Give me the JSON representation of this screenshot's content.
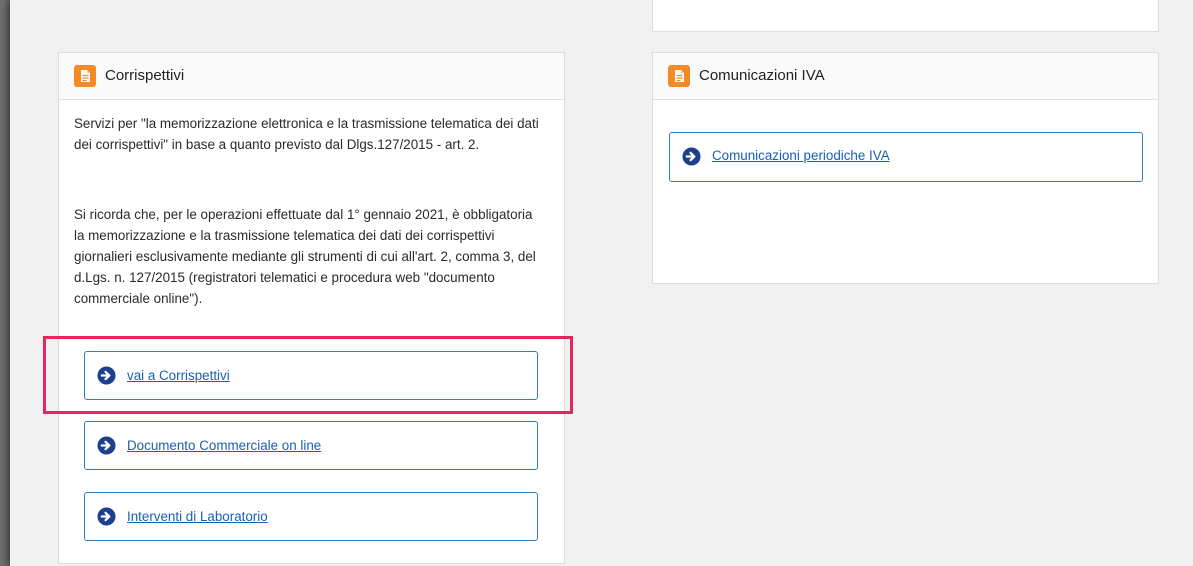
{
  "corrispettivi": {
    "title": "Corrispettivi",
    "paragraph1": "Servizi per \"la memorizzazione elettronica e la trasmissione telematica dei dati dei corrispettivi\" in base a quanto previsto dal Dlgs.127/2015 - art. 2.",
    "paragraph2": "Si ricorda che, per le operazioni effettuate dal 1° gennaio 2021, è obbligatoria la memorizzazione e la trasmissione telematica dei dati dei corrispettivi giornalieri esclusivamente mediante gli strumenti di cui all'art. 2, comma 3, del d.Lgs. n. 127/2015 (registratori telematici e procedura web \"documento commerciale online\").",
    "links": [
      {
        "label": "vai a Corrispettivi"
      },
      {
        "label": "Documento Commerciale on line"
      },
      {
        "label": "Interventi di Laboratorio"
      }
    ]
  },
  "comunicazioni_iva": {
    "title": "Comunicazioni IVA",
    "links": [
      {
        "label": "Comunicazioni periodiche IVA"
      }
    ]
  },
  "colors": {
    "accent_icon": "#f28a26",
    "link_border": "#2d7fc4",
    "link_text": "#1a5fb4",
    "highlight": "#e8265e"
  },
  "icons": {
    "card_header": "document-icon",
    "link": "arrow-circle-right-icon"
  }
}
